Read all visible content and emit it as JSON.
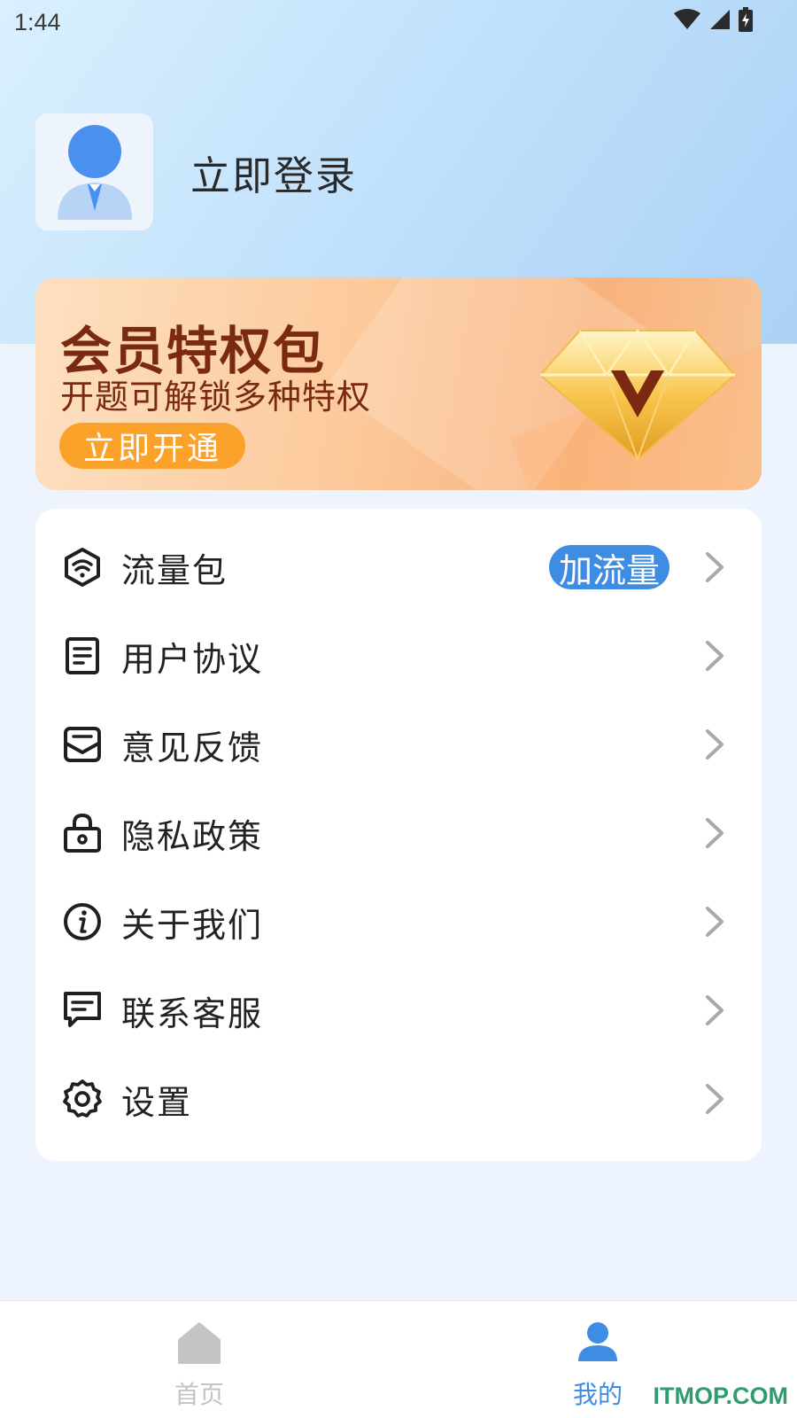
{
  "status_bar": {
    "time": "1:44",
    "icons": [
      "wifi-icon",
      "signal-icon",
      "battery-icon"
    ]
  },
  "profile": {
    "avatar_icon": "user-avatar-icon",
    "login_label": "立即登录"
  },
  "vip_banner": {
    "title": "会员特权包",
    "subtitle": "开题可解锁多种特权",
    "button_label": "立即开通",
    "image_icon": "vip-diamond-icon"
  },
  "menu": {
    "items": [
      {
        "label": "流量包",
        "icon": "data-package-icon",
        "badge": "加流量"
      },
      {
        "label": "用户协议",
        "icon": "document-icon"
      },
      {
        "label": "意见反馈",
        "icon": "feedback-mail-icon"
      },
      {
        "label": "隐私政策",
        "icon": "lock-icon"
      },
      {
        "label": "关于我们",
        "icon": "info-icon"
      },
      {
        "label": "联系客服",
        "icon": "chat-icon"
      },
      {
        "label": "设置",
        "icon": "gear-icon"
      }
    ]
  },
  "tab_bar": {
    "tabs": [
      {
        "label": "首页",
        "icon": "home-icon",
        "active": false
      },
      {
        "label": "我的",
        "icon": "person-icon",
        "active": true
      }
    ]
  },
  "watermark": "ITMOP.COM",
  "colors": {
    "accent": "#3f8de3",
    "vip_button": "#fba22b",
    "vip_text": "#7a2a10",
    "inactive_tab": "#c4c4c4"
  }
}
